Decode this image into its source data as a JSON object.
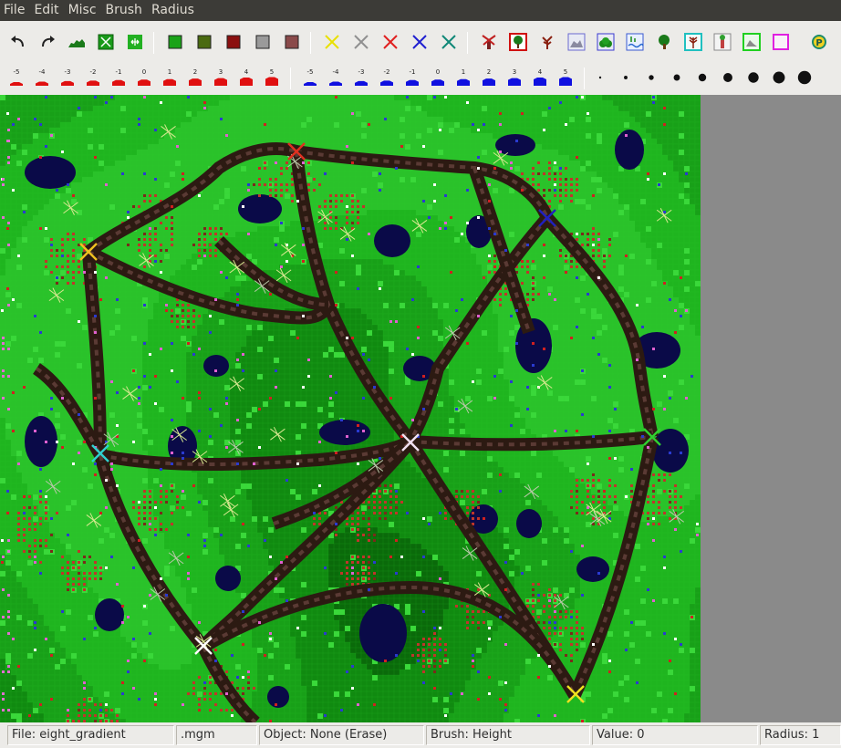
{
  "menubar": {
    "items": [
      "File",
      "Edit",
      "Misc",
      "Brush",
      "Radius"
    ]
  },
  "toolbar": {
    "history": [
      "undo-icon",
      "redo-icon"
    ],
    "terrain_tools": [
      "raise-terrain-icon",
      "random-fill-icon",
      "smooth-icon"
    ],
    "color_swatches": [
      "#1aa318",
      "#4a6a10",
      "#8b1010",
      "#9a9a9a",
      "#8a4a4a"
    ],
    "cross_markers": [
      "#e8e000",
      "#909090",
      "#e02020",
      "#2020d0",
      "#108878"
    ],
    "object_icons": [
      "windmill-icon",
      "red-tree-icon",
      "dead-tree-icon",
      "rock-icon",
      "bush-icon",
      "water-icon",
      "oak-tree-icon",
      "cyan-plant-icon",
      "tall-plant-icon",
      "green-rock-icon",
      "magenta-frame-icon",
      "parking-icon"
    ]
  },
  "brush_row": {
    "red_values": [
      "-5",
      "-4",
      "-3",
      "-2",
      "-1",
      "0",
      "1",
      "2",
      "3",
      "4",
      "5"
    ],
    "blue_values": [
      "-5",
      "-4",
      "-3",
      "-2",
      "-1",
      "0",
      "1",
      "2",
      "3",
      "4",
      "5"
    ],
    "radius_dot_count": 9
  },
  "map": {
    "markers": [
      {
        "color": "#e03020",
        "label": "red"
      },
      {
        "color": "#f0c020",
        "label": "yellow"
      },
      {
        "color": "#2020c0",
        "label": "blue"
      },
      {
        "color": "#30d0d0",
        "label": "cyan"
      },
      {
        "color": "#f0e0f0",
        "label": "white"
      },
      {
        "color": "#30d030",
        "label": "green"
      },
      {
        "color": "#ffffff",
        "label": "white"
      },
      {
        "color": "#f0e020",
        "label": "yellow"
      }
    ]
  },
  "statusbar": {
    "file": "File: eight_gradient",
    "ext": ".mgm",
    "object": "Object: None (Erase)",
    "brush": "Brush: Height",
    "value": "Value: 0",
    "radius": "Radius: 1"
  }
}
